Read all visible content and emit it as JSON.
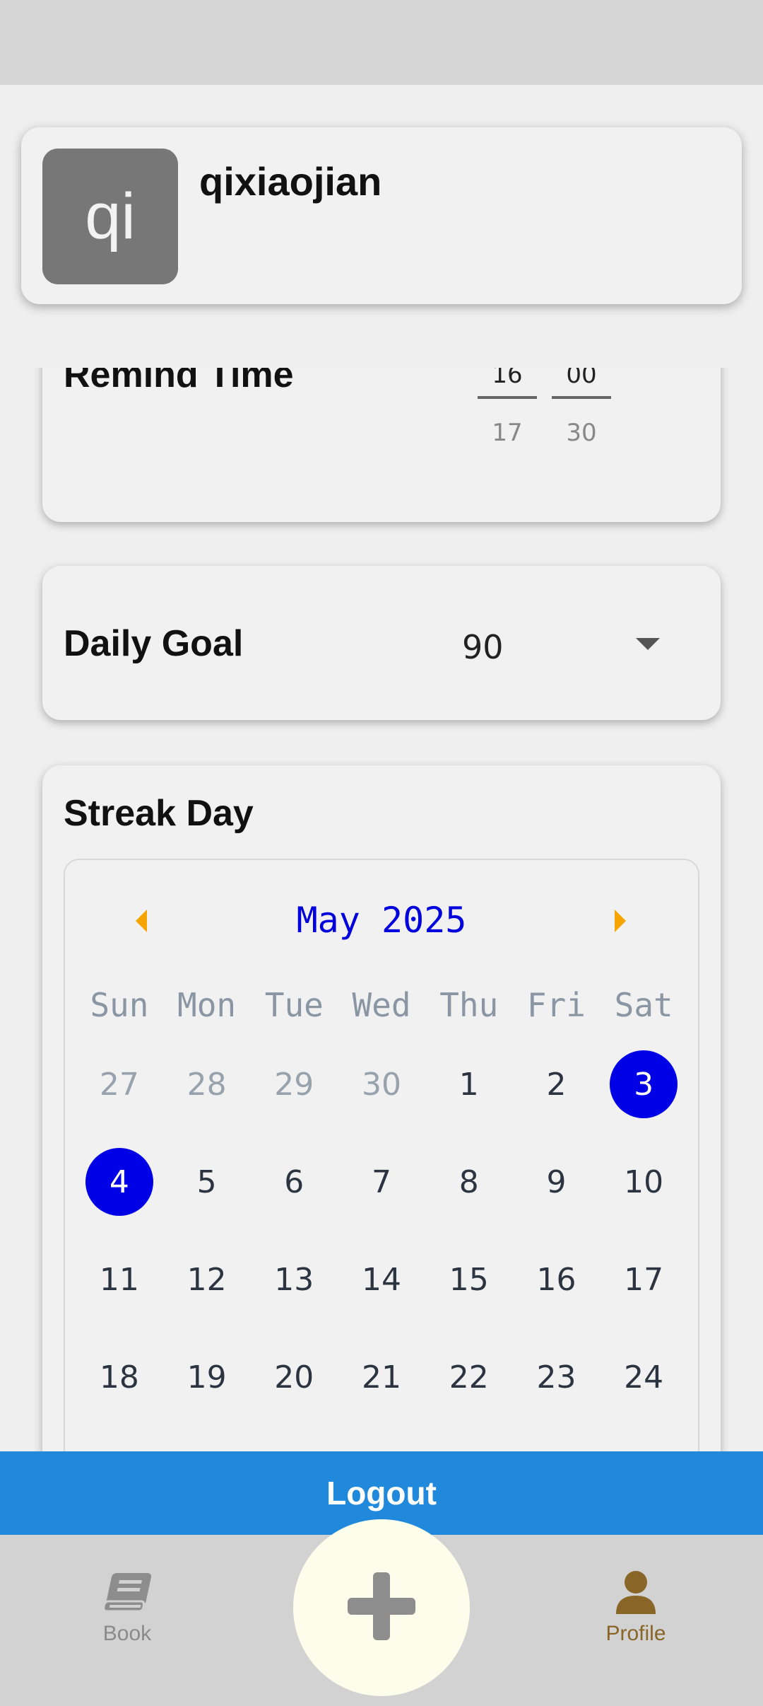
{
  "profile": {
    "avatar_initials": "qi",
    "username": "qixiaojian"
  },
  "remind": {
    "title": "Remind Time",
    "hour_current": "16",
    "hour_next": "17",
    "minute_current": "00",
    "minute_next": "30"
  },
  "goal": {
    "title": "Daily Goal",
    "value": "90"
  },
  "streak": {
    "title": "Streak Day",
    "month": "May 2025",
    "weekdays": [
      "Sun",
      "Mon",
      "Tue",
      "Wed",
      "Thu",
      "Fri",
      "Sat"
    ],
    "weeks": [
      [
        "27",
        "28",
        "29",
        "30",
        "1",
        "2",
        "3"
      ],
      [
        "4",
        "5",
        "6",
        "7",
        "8",
        "9",
        "10"
      ],
      [
        "11",
        "12",
        "13",
        "14",
        "15",
        "16",
        "17"
      ],
      [
        "18",
        "19",
        "20",
        "21",
        "22",
        "23",
        "24"
      ]
    ],
    "outside_days": [
      "27",
      "28",
      "29",
      "30"
    ],
    "selected_days": [
      "3",
      "4"
    ],
    "selected_color": "#0000e6",
    "arrow_color": "#f5a400"
  },
  "logout_label": "Logout",
  "nav": {
    "book_label": "Book",
    "profile_label": "Profile",
    "book_icon": "book-icon",
    "profile_icon": "person-icon",
    "add_icon": "plus-icon",
    "active_color": "#8a6528"
  }
}
